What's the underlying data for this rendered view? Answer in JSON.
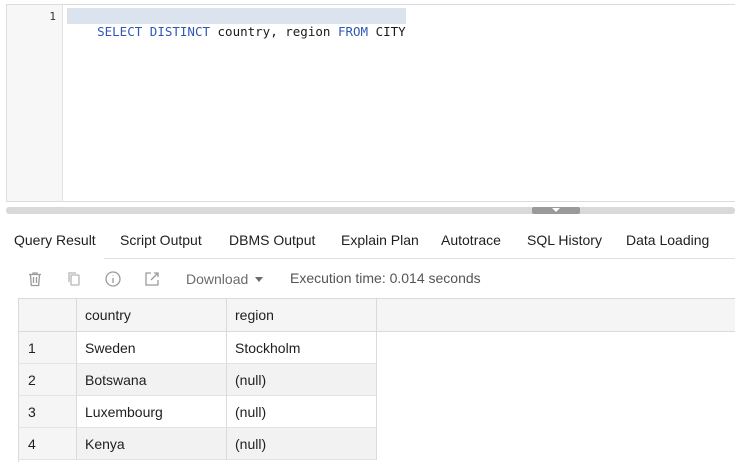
{
  "editor": {
    "line_number": "1",
    "code_tokens": [
      {
        "text": "SELECT DISTINCT",
        "kind": "kw"
      },
      {
        "text": " country, region ",
        "kind": "txt"
      },
      {
        "text": "FROM",
        "kind": "kw"
      },
      {
        "text": " CITY",
        "kind": "txt"
      }
    ]
  },
  "tabs": [
    {
      "label": "Query Result",
      "active": true
    },
    {
      "label": "Script Output",
      "active": false
    },
    {
      "label": "DBMS Output",
      "active": false
    },
    {
      "label": "Explain Plan",
      "active": false
    },
    {
      "label": "Autotrace",
      "active": false
    },
    {
      "label": "SQL History",
      "active": false
    },
    {
      "label": "Data Loading",
      "active": false
    }
  ],
  "toolbar": {
    "icons": [
      "trash-icon",
      "copy-icon",
      "info-icon",
      "open-external-icon"
    ],
    "download_label": "Download",
    "execution_time": "Execution time: 0.014 seconds"
  },
  "grid": {
    "columns": [
      "country",
      "region"
    ],
    "rows": [
      {
        "num": "1",
        "country": "Sweden",
        "region": "Stockholm"
      },
      {
        "num": "2",
        "country": "Botswana",
        "region": "(null)"
      },
      {
        "num": "3",
        "country": "Luxembourg",
        "region": "(null)"
      },
      {
        "num": "4",
        "country": "Kenya",
        "region": "(null)"
      }
    ]
  },
  "colors": {
    "keyword": "#2f57b8",
    "selection": "#dbe3ee",
    "header_bg": "#f5f5f5"
  }
}
